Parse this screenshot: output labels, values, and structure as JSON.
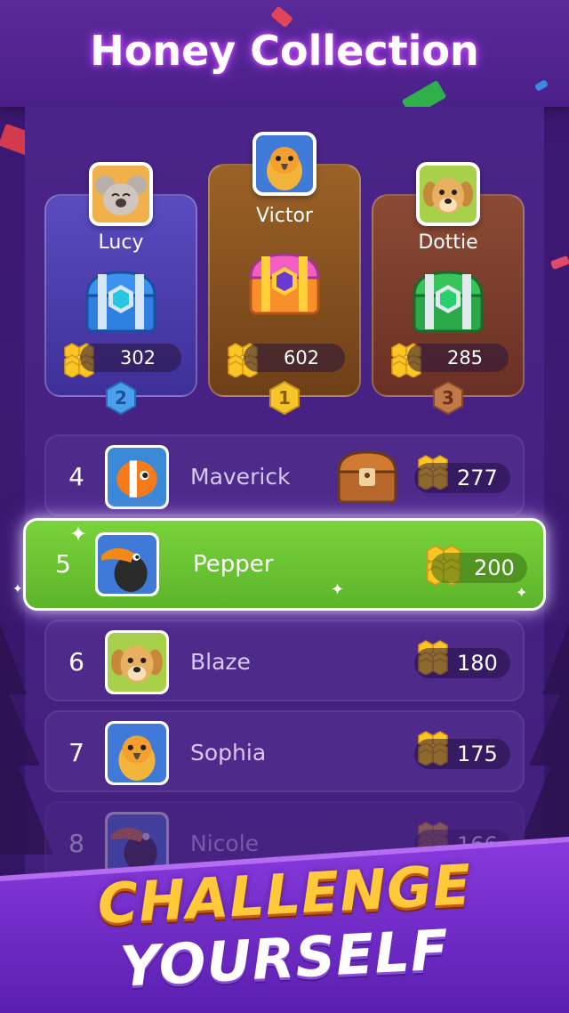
{
  "title": "Honey Collection",
  "podium": [
    {
      "place": "2",
      "name": "Lucy",
      "score": "302",
      "avatar": "koala-avatar",
      "chest": "blue-chest-icon",
      "color": "#4b3aa6"
    },
    {
      "place": "1",
      "name": "Victor",
      "score": "602",
      "avatar": "parrot-avatar",
      "chest": "pink-chest-icon",
      "color": "#8a5220"
    },
    {
      "place": "3",
      "name": "Dottie",
      "score": "285",
      "avatar": "dog-avatar",
      "chest": "green-chest-icon",
      "color": "#7a3b2a"
    }
  ],
  "rows": [
    {
      "rank": "4",
      "name": "Maverick",
      "score": "277",
      "avatar": "clownfish-avatar",
      "reward": "wooden-chest-icon"
    },
    {
      "rank": "5",
      "name": "Pepper",
      "score": "200",
      "avatar": "toucan-avatar",
      "highlight": true
    },
    {
      "rank": "6",
      "name": "Blaze",
      "score": "180",
      "avatar": "dog-avatar"
    },
    {
      "rank": "7",
      "name": "Sophia",
      "score": "175",
      "avatar": "parrot-avatar"
    },
    {
      "rank": "8",
      "name": "Nicole",
      "score": "166",
      "avatar": "toucan-avatar",
      "faded": true
    }
  ],
  "banner": {
    "line1": "CHALLENGE",
    "line2": "YOURSELF"
  },
  "colors": {
    "highlight_green": "#6cc632",
    "gold": "#f6c52a",
    "row_bg": "#4e2a8a"
  }
}
